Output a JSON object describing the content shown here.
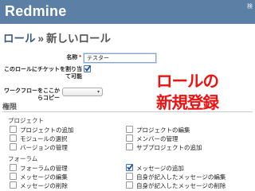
{
  "header": {
    "logo": "Redmine",
    "search_label": "検"
  },
  "breadcrumb": {
    "parent": "ロール",
    "separator": "»",
    "current": "新しいロール"
  },
  "form": {
    "name_label": "名称",
    "required_mark": "*",
    "name_value": "テスター",
    "assignable_label_line1": "このロールにチケットを割り当",
    "assignable_label_line2": "て可能",
    "assignable_checked": true,
    "workflow_copy_label": "ワークフローをここからコピー",
    "workflow_copy_value": ""
  },
  "overlay_text": {
    "line1": "ロールの",
    "line2": "新規登録"
  },
  "permissions": {
    "title": "権限",
    "groups": [
      {
        "name": "プロジェクト",
        "items": [
          {
            "label": "プロジェクトの追加",
            "checked": false
          },
          {
            "label": "プロジェクトの編集",
            "checked": false
          },
          {
            "label": "モジュールの選択",
            "checked": false
          },
          {
            "label": "メンバーの管理",
            "checked": false
          },
          {
            "label": "バージョンの管理",
            "checked": false
          },
          {
            "label": "サブプロジェクトの追加",
            "checked": false
          }
        ]
      },
      {
        "name": "フォーラム",
        "items": [
          {
            "label": "フォーラムの管理",
            "checked": false
          },
          {
            "label": "メッセージの追加",
            "checked": true
          },
          {
            "label": "メッセージの編集",
            "checked": false
          },
          {
            "label": "自身が記入したメッセージの編集",
            "checked": false
          },
          {
            "label": "メッセージの削除",
            "checked": false
          },
          {
            "label": "自身が記入したメッセージの削除",
            "checked": false
          }
        ]
      }
    ]
  }
}
